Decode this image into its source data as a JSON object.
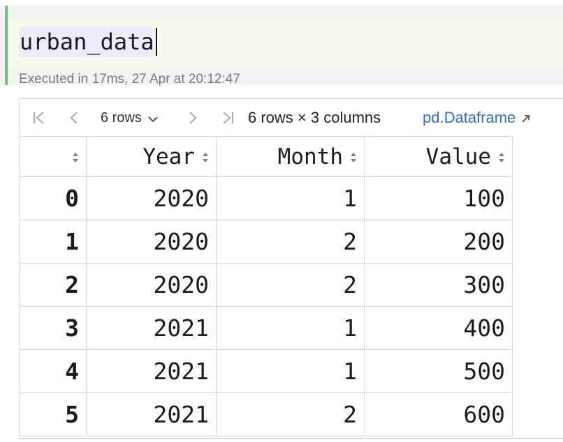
{
  "cell": {
    "code": "urban_data",
    "execution_info": "Executed in 17ms, 27 Apr at 20:12:47"
  },
  "toolbar": {
    "page_size": "6 rows",
    "dimensions": "6 rows × 3 columns",
    "dataframe_link": "pd.Dataframe"
  },
  "table": {
    "columns": [
      "Year",
      "Month",
      "Value"
    ],
    "rows": [
      {
        "index": "0",
        "year": "2020",
        "month": "1",
        "value": "100"
      },
      {
        "index": "1",
        "year": "2020",
        "month": "2",
        "value": "200"
      },
      {
        "index": "2",
        "year": "2020",
        "month": "2",
        "value": "300"
      },
      {
        "index": "3",
        "year": "2021",
        "month": "1",
        "value": "400"
      },
      {
        "index": "4",
        "year": "2021",
        "month": "1",
        "value": "500"
      },
      {
        "index": "5",
        "year": "2021",
        "month": "2",
        "value": "600"
      }
    ]
  },
  "icons": {
    "first_page": "first-page-icon",
    "prev_page": "previous-page-icon",
    "next_page": "next-page-icon",
    "last_page": "last-page-icon",
    "dropdown": "chevron-down-icon",
    "sort": "sort-icon",
    "open_external": "arrow-up-right-icon"
  },
  "colors": {
    "cell_bar": "#6fc27c",
    "link": "#2f6fb6",
    "code_background": "#fbfaf0",
    "selection": "#ececfb"
  }
}
